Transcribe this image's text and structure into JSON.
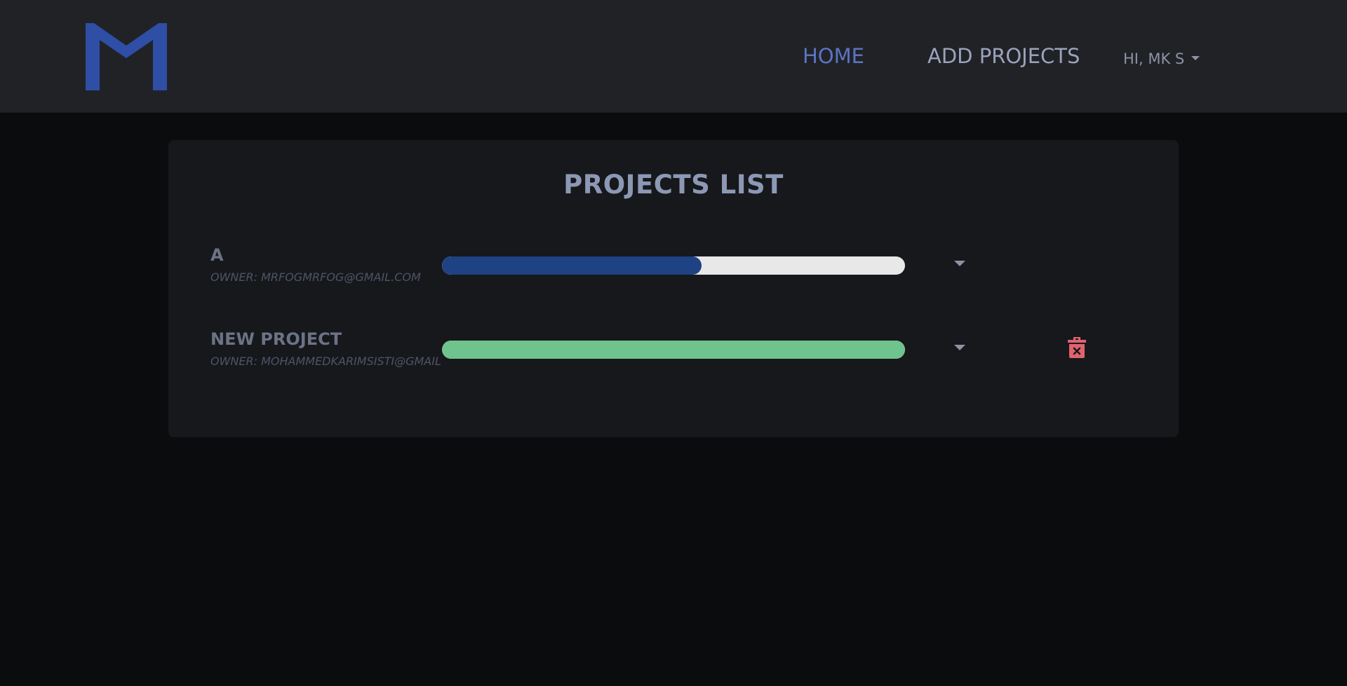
{
  "nav": {
    "home_label": "HOME",
    "add_projects_label": "ADD PROJECTS",
    "user_greeting": "HI, MK S"
  },
  "main": {
    "title": "PROJECTS LIST",
    "projects": [
      {
        "name": "A",
        "owner": "OWNER: MRFOGMRFOG@GMAIL.COM",
        "progress": 0.56,
        "bar_color": "#1e4283",
        "deletable": false
      },
      {
        "name": "NEW PROJECT",
        "owner": "OWNER: MOHAMMEDKARIMSISTI@GMAIL.COM",
        "progress": 1.0,
        "bar_color": "#6fc38c",
        "deletable": true
      }
    ]
  },
  "colors": {
    "accent": "#5b74c4",
    "logo": "#2f4ea6",
    "delete": "#e0636e"
  }
}
